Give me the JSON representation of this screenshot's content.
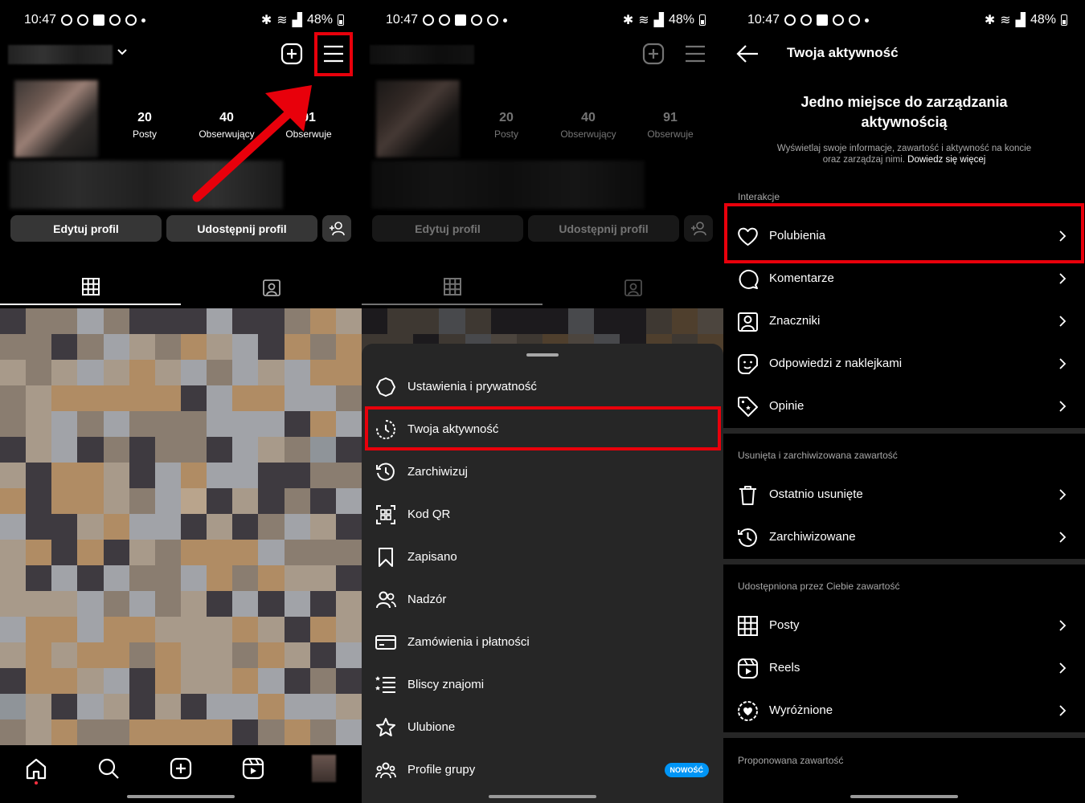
{
  "status_bar": {
    "time": "10:47",
    "battery": "48%"
  },
  "profile": {
    "stats": [
      {
        "value": "20",
        "label": "Posty"
      },
      {
        "value": "40",
        "label": "Obserwujący"
      },
      {
        "value": "91",
        "label": "Obserwuje"
      }
    ],
    "edit_button": "Edytuj profil",
    "share_button": "Udostępnij profil"
  },
  "menu": {
    "items": [
      {
        "label": "Ustawienia i prywatność",
        "icon": "settings-icon"
      },
      {
        "label": "Twoja aktywność",
        "icon": "activity-icon"
      },
      {
        "label": "Zarchiwizuj",
        "icon": "archive-icon"
      },
      {
        "label": "Kod QR",
        "icon": "qr-code-icon"
      },
      {
        "label": "Zapisano",
        "icon": "bookmark-icon"
      },
      {
        "label": "Nadzór",
        "icon": "supervision-icon"
      },
      {
        "label": "Zamówienia i płatności",
        "icon": "card-icon"
      },
      {
        "label": "Bliscy znajomi",
        "icon": "close-friends-icon"
      },
      {
        "label": "Ulubione",
        "icon": "star-icon"
      },
      {
        "label": "Profile grupy",
        "icon": "group-icon"
      }
    ],
    "badge_new": "NOWOŚĆ"
  },
  "activity": {
    "title": "Twoja aktywność",
    "heading": "Jedno miejsce do zarządzania aktywnością",
    "description": "Wyświetlaj swoje informacje, zawartość i aktywność na koncie oraz zarządzaj nimi.",
    "learn_more": "Dowiedz się więcej",
    "sections": [
      {
        "label": "Interakcje",
        "items": [
          "Polubienia",
          "Komentarze",
          "Znaczniki",
          "Odpowiedzi z naklejkami",
          "Opinie"
        ]
      },
      {
        "label": "Usunięta i zarchiwizowana zawartość",
        "items": [
          "Ostatnio usunięte",
          "Zarchiwizowane"
        ]
      },
      {
        "label": "Udostępniona przez Ciebie zawartość",
        "items": [
          "Posty",
          "Reels",
          "Wyróżnione"
        ]
      },
      {
        "label": "Proponowana zawartość",
        "items": []
      }
    ]
  },
  "colors": {
    "highlight": "#e8000b",
    "badge": "#0095f6",
    "sheet": "#262626",
    "button": "#363636"
  }
}
